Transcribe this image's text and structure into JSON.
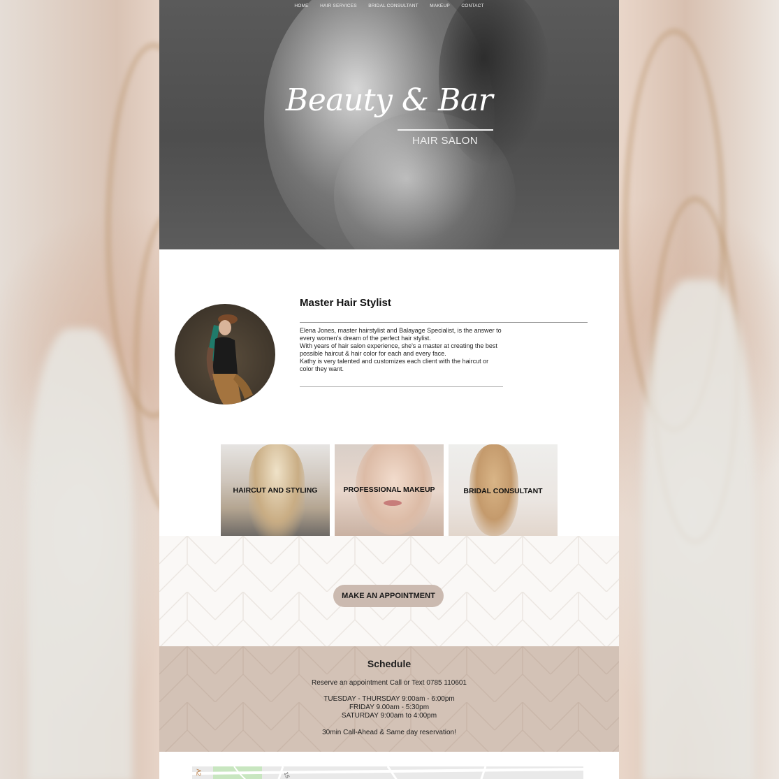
{
  "nav": {
    "items": [
      "HOME",
      "HAIR SERVICES",
      "BRIDAL CONSULTANT",
      "MAKEUP",
      "CONTACT"
    ]
  },
  "hero": {
    "title": "Beauty & Bar",
    "subtitle": "HAIR SALON"
  },
  "about": {
    "heading": "Master Hair Stylist",
    "paragraphs": [
      "Elena Jones, master hairstylist and Balayage Specialist, is the answer to every women's dream of the perfect hair stylist.",
      "With years of hair salon experience, she's a master at creating the best possible haircut & hair color for each and every face.",
      "Kathy is very talented and customizes each client with the haircut or color they want."
    ]
  },
  "services": [
    {
      "label": "HAIRCUT AND STYLING"
    },
    {
      "label": "PROFESSIONAL MAKEUP"
    },
    {
      "label": "BRIDAL CONSULTANT"
    }
  ],
  "cta": {
    "appointment_label": "MAKE AN APPOINTMENT"
  },
  "schedule": {
    "title": "Schedule",
    "contact": "Reserve an appointment Call or Text 0785 110601",
    "hours": [
      "TUESDAY - THURSDAY 9:00am - 6:00pm",
      "FRIDAY 9.00am - 5:30pm",
      "SATURDAY 9:00am to 4:00pm"
    ],
    "note": "30min Call-Ahead & Same day reservation!"
  },
  "map": {
    "labels": [
      "A2",
      "15"
    ]
  },
  "colors": {
    "accent": "#cbbab0",
    "schedule_bg": "#d3c2b6",
    "hero_bg": "#555555"
  }
}
